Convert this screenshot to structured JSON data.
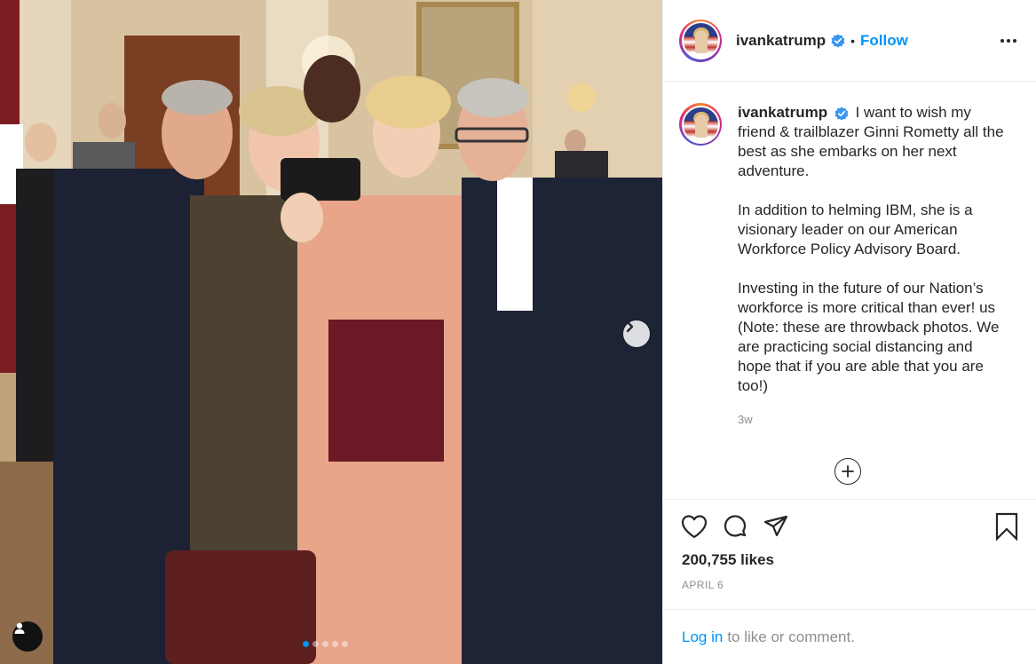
{
  "post": {
    "username": "ivankatrump",
    "separator": "•",
    "follow_label": "Follow",
    "caption_paragraphs": [
      "I want to wish my friend & trailblazer Ginni Rometty all the best as she embarks on her next adventure.",
      "In addition to helming IBM, she is a visionary leader on our American Workforce Policy Advisory Board.",
      "Investing in the future of our Nation’s workforce is more critical than ever! us (Note: these are throwback photos. We are practicing social distancing and hope that if you are able that you are too!)"
    ],
    "caption_time": "3w",
    "likes": "200,755 likes",
    "date": "APRIL 6",
    "login_link": "Log in",
    "login_suffix": "to like or comment."
  },
  "carousel": {
    "total": 5,
    "active_index": 0
  },
  "icons": {
    "verified": "verified-badge-icon",
    "more": "more-options-icon",
    "next": "chevron-right-icon",
    "user_tag": "user-tag-icon",
    "load_more": "plus-circle-icon",
    "like": "heart-icon",
    "comment": "comment-icon",
    "share": "paper-plane-icon",
    "save": "bookmark-icon"
  },
  "colors": {
    "accent": "#0095f6",
    "text": "#262626",
    "muted": "#8e8e8e",
    "border": "#efefef"
  }
}
